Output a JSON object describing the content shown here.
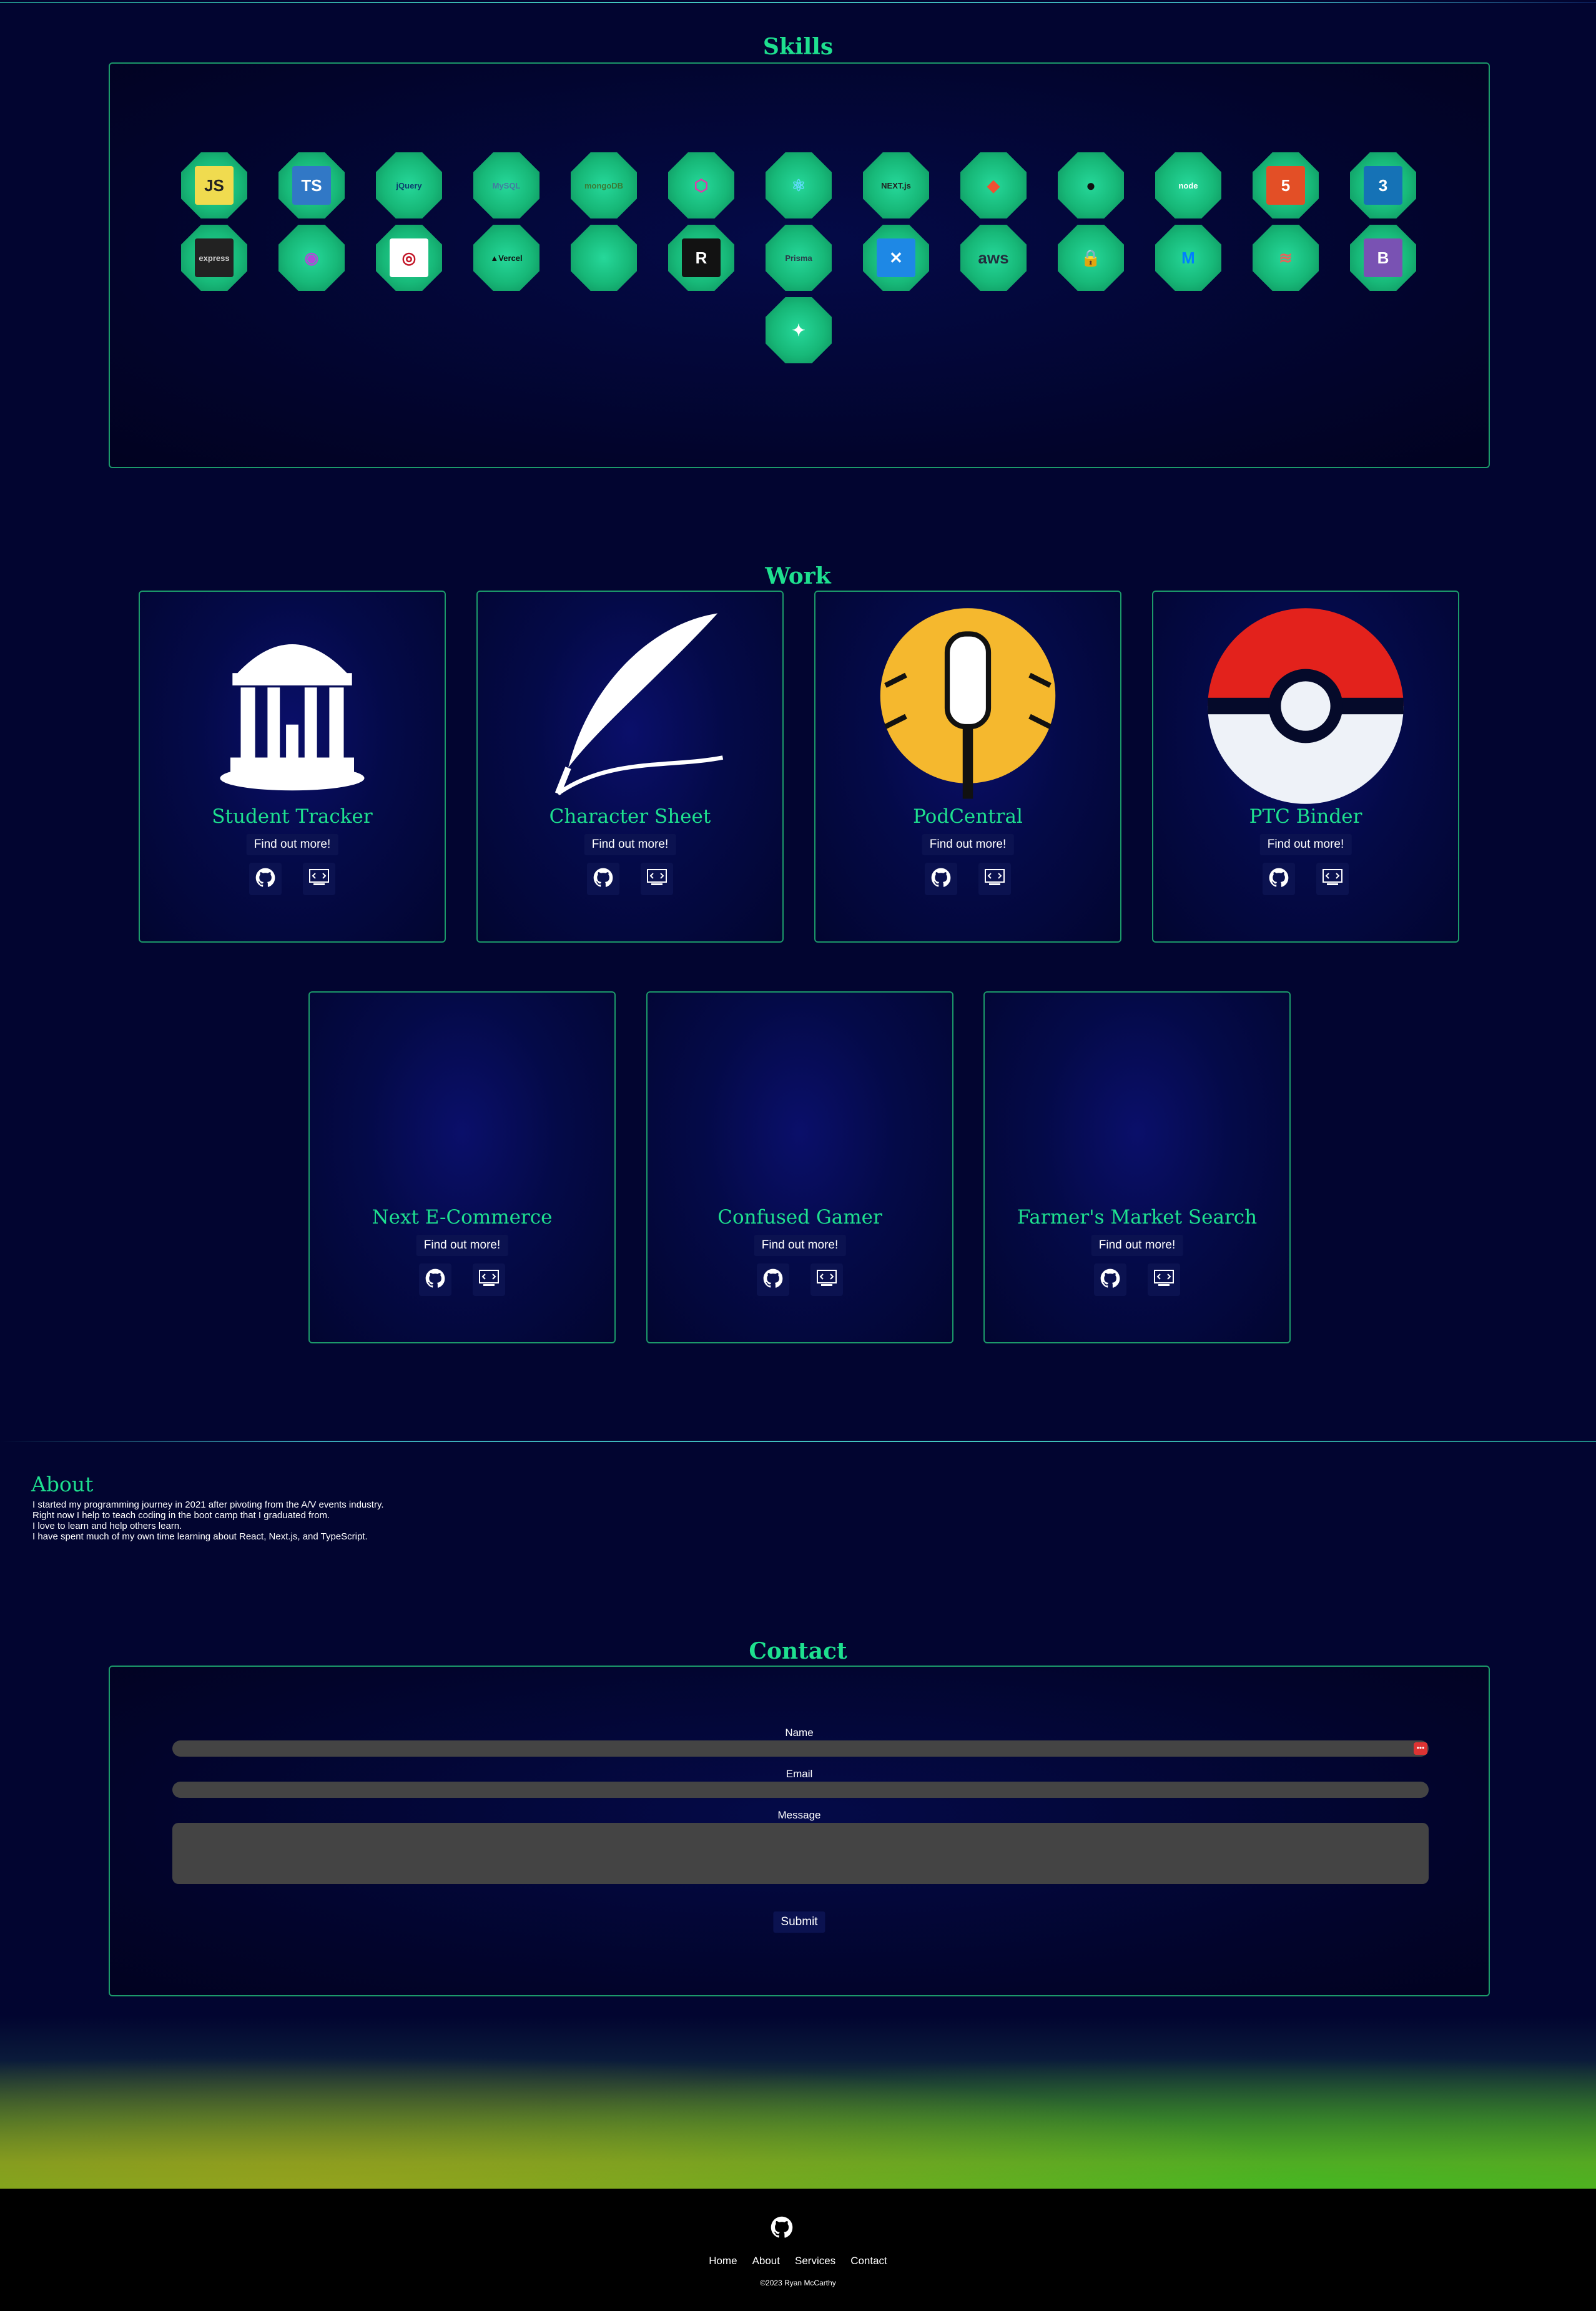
{
  "skills": {
    "title": "Skills",
    "items": [
      {
        "name": "javascript",
        "label": "JS",
        "bg": "#f0db4f",
        "fg": "#222"
      },
      {
        "name": "typescript",
        "label": "TS",
        "bg": "#3178c6",
        "fg": "#fff"
      },
      {
        "name": "jquery",
        "label": "jQuery",
        "bg": "transparent",
        "fg": "#0b3d6e"
      },
      {
        "name": "mysql",
        "label": "MySQL",
        "bg": "transparent",
        "fg": "#4479a1"
      },
      {
        "name": "mongodb",
        "label": "mongoDB",
        "bg": "transparent",
        "fg": "#3b7a35"
      },
      {
        "name": "graphql",
        "label": "⬡",
        "bg": "transparent",
        "fg": "#e535ab"
      },
      {
        "name": "react",
        "label": "⚛",
        "bg": "transparent",
        "fg": "#61dafb"
      },
      {
        "name": "nextjs",
        "label": "NEXT.js",
        "bg": "transparent",
        "fg": "#222"
      },
      {
        "name": "git",
        "label": "◆",
        "bg": "transparent",
        "fg": "#f05032"
      },
      {
        "name": "github",
        "label": "●",
        "bg": "transparent",
        "fg": "#111"
      },
      {
        "name": "nodejs",
        "label": "node",
        "bg": "transparent",
        "fg": "#fff"
      },
      {
        "name": "html5",
        "label": "5",
        "bg": "#e34f26",
        "fg": "#fff"
      },
      {
        "name": "css3",
        "label": "3",
        "bg": "#1572b6",
        "fg": "#fff"
      },
      {
        "name": "express",
        "label": "express",
        "bg": "#222",
        "fg": "#ccc"
      },
      {
        "name": "auth",
        "label": "◉",
        "bg": "transparent",
        "fg": "#b04ad8"
      },
      {
        "name": "jest",
        "label": "◎",
        "bg": "#fff",
        "fg": "#c21325"
      },
      {
        "name": "vercel",
        "label": "▲Vercel",
        "bg": "transparent",
        "fg": "#111"
      },
      {
        "name": "ruby",
        "label": "",
        "bg": "transparent",
        "fg": "#fff"
      },
      {
        "name": "remix",
        "label": "R",
        "bg": "#121212",
        "fg": "#fff"
      },
      {
        "name": "prisma",
        "label": "Prisma",
        "bg": "transparent",
        "fg": "#2d3748"
      },
      {
        "name": "jira",
        "label": "✕",
        "bg": "#1e88e5",
        "fg": "#fff"
      },
      {
        "name": "aws",
        "label": "aws",
        "bg": "transparent",
        "fg": "#232f3e"
      },
      {
        "name": "security",
        "label": "🔒",
        "bg": "transparent",
        "fg": "#111"
      },
      {
        "name": "material-ui",
        "label": "M",
        "bg": "transparent",
        "fg": "#007fff"
      },
      {
        "name": "heroku",
        "label": "≋",
        "bg": "transparent",
        "fg": "#e7645a"
      },
      {
        "name": "bootstrap",
        "label": "B",
        "bg": "#7952b3",
        "fg": "#fff"
      },
      {
        "name": "cypress",
        "label": "✦",
        "bg": "transparent",
        "fg": "#fff"
      }
    ]
  },
  "work": {
    "title": "Work",
    "more_label": "Find out more!",
    "projects": [
      {
        "title": "Student Tracker",
        "image": "well-icon"
      },
      {
        "title": "Character Sheet",
        "image": "quill-icon"
      },
      {
        "title": "PodCentral",
        "image": "microphone-icon"
      },
      {
        "title": "PTC Binder",
        "image": "pokeball-icon"
      },
      {
        "title": "Next E-Commerce",
        "image": ""
      },
      {
        "title": "Confused Gamer",
        "image": ""
      },
      {
        "title": "Farmer's Market Search",
        "image": ""
      }
    ]
  },
  "about": {
    "title": "About",
    "lines": [
      "I started my programming journey in 2021 after pivoting from the A/V events industry.",
      "Right now I help to teach coding in the boot camp that I graduated from.",
      "I love to learn and help others learn.",
      "I have spent much of my own time learning about React, Next.js, and TypeScript."
    ]
  },
  "contact": {
    "title": "Contact",
    "name_label": "Name",
    "email_label": "Email",
    "message_label": "Message",
    "submit_label": "Submit"
  },
  "footer": {
    "nav": [
      "Home",
      "About",
      "Services",
      "Contact"
    ],
    "copyright": "©2023 Ryan McCarthy"
  },
  "colors": {
    "accent": "#1ee08f",
    "background": "#020530",
    "border": "#1c9a6a"
  }
}
